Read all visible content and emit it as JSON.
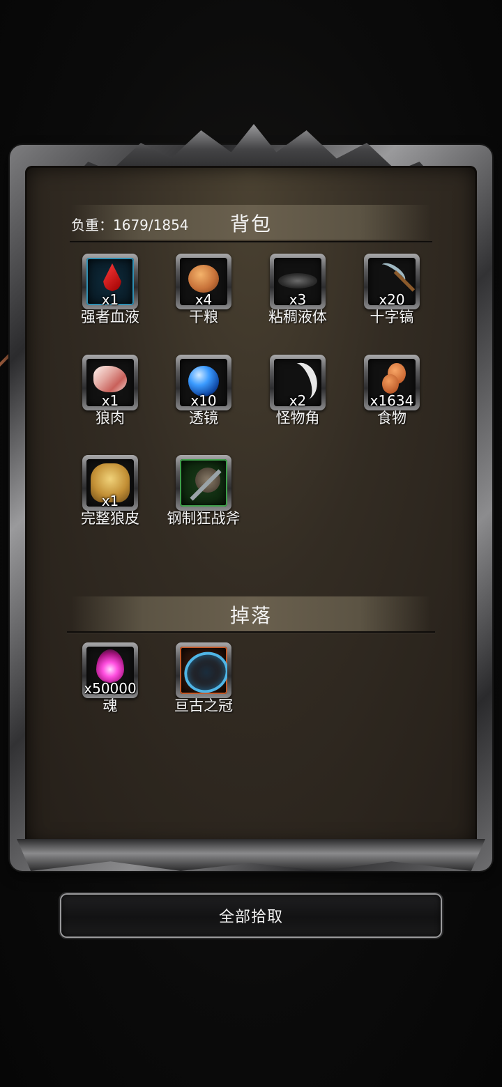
{
  "panel": {
    "weight_label": "负重：1679/1854",
    "backpack_title": "背包",
    "drop_title": "掉落"
  },
  "backpack_items": [
    {
      "name": "强者血液",
      "qty": "x1",
      "icon": "blood-drop-icon",
      "rarity": "blue"
    },
    {
      "name": "干粮",
      "qty": "x4",
      "icon": "bread-icon",
      "rarity": "gray"
    },
    {
      "name": "粘稠液体",
      "qty": "x3",
      "icon": "sticky-liquid-icon",
      "rarity": "gray"
    },
    {
      "name": "十字镐",
      "qty": "x20",
      "icon": "pickaxe-icon",
      "rarity": "gray"
    },
    {
      "name": "狼肉",
      "qty": "x1",
      "icon": "wolf-meat-icon",
      "rarity": "gray"
    },
    {
      "name": "透镜",
      "qty": "x10",
      "icon": "lens-icon",
      "rarity": "gray"
    },
    {
      "name": "怪物角",
      "qty": "x2",
      "icon": "monster-horn-icon",
      "rarity": "gray"
    },
    {
      "name": "食物",
      "qty": "x1634",
      "icon": "food-icon",
      "rarity": "gray"
    },
    {
      "name": "完整狼皮",
      "qty": "x1",
      "icon": "wolf-pelt-icon",
      "rarity": "gray"
    },
    {
      "name": "钢制狂战斧",
      "qty": "",
      "icon": "berserker-axe-icon",
      "rarity": "green"
    }
  ],
  "drop_items": [
    {
      "name": "魂",
      "qty": "x50000",
      "icon": "soul-icon",
      "rarity": "gray"
    },
    {
      "name": "亘古之冠",
      "qty": "",
      "icon": "ancient-crown-icon",
      "rarity": "orange"
    }
  ],
  "actions": {
    "pick_all_label": "全部拾取"
  }
}
